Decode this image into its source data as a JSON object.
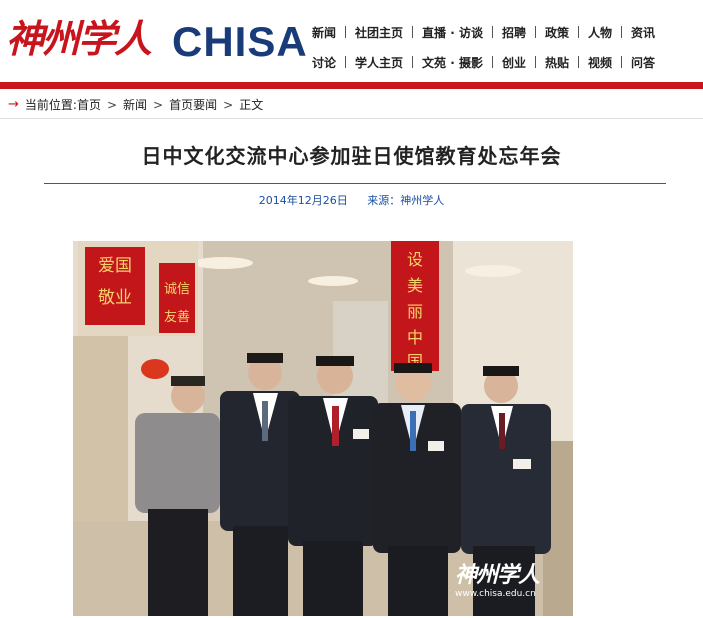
{
  "header": {
    "logo_cn": "神州学人",
    "logo_en": "CHISA",
    "nav_row1": [
      "新闻",
      "社团主页",
      "直播 · 访谈",
      "招聘",
      "政策",
      "人物",
      "资讯"
    ],
    "nav_row2": [
      "讨论",
      "学人主页",
      "文苑 · 摄影",
      "创业",
      "热贴",
      "视频",
      "问答"
    ]
  },
  "breadcrumb": {
    "label": "当前位置:",
    "items": [
      "首页",
      "新闻",
      "首页要闻",
      "正文"
    ]
  },
  "article": {
    "title": "日中文化交流中心参加驻日使馆教育处忘年会",
    "date": "2014年12月26日",
    "source": "来源：神州学人"
  },
  "photo": {
    "banner_left_1": "爱国",
    "banner_left_2": "敬业",
    "banner_left_3": "诚信",
    "banner_left_4": "友善",
    "banner_right": "设美丽中国",
    "watermark_cn": "神州学人",
    "watermark_url": "www.chisa.edu.cn"
  },
  "colors": {
    "brand_red": "#c8141c",
    "brand_blue": "#1a3b7a",
    "link_blue": "#1a4fa3"
  }
}
